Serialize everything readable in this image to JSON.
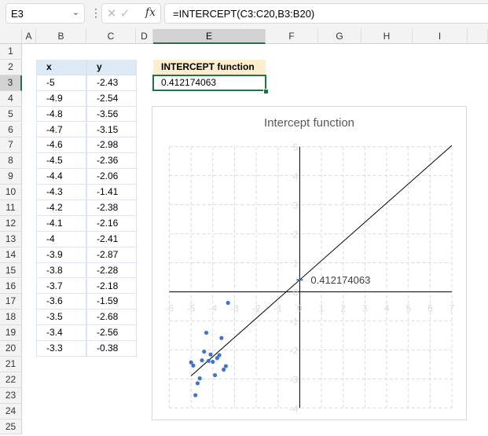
{
  "name_box": {
    "value": "E3"
  },
  "formula_bar": {
    "value": "=INTERCEPT(C3:C20,B3:B20)",
    "cancel_icon": "x-icon",
    "enter_icon": "check-icon",
    "fx_label": "fx"
  },
  "columns": [
    "A",
    "B",
    "C",
    "D",
    "E",
    "F",
    "G",
    "H",
    "I"
  ],
  "selected_column": "E",
  "rows": [
    "1",
    "2",
    "3",
    "4",
    "5",
    "6",
    "7",
    "8",
    "9",
    "10",
    "11",
    "12",
    "13",
    "14",
    "15",
    "16",
    "17",
    "18",
    "19",
    "20",
    "21",
    "22",
    "23",
    "24",
    "25"
  ],
  "selected_row": "3",
  "table": {
    "headers": [
      "x",
      "y"
    ],
    "x": [
      "-5",
      "-4.9",
      "-4.8",
      "-4.7",
      "-4.6",
      "-4.5",
      "-4.4",
      "-4.3",
      "-4.2",
      "-4.1",
      "-4",
      "-3.9",
      "-3.8",
      "-3.7",
      "-3.6",
      "-3.5",
      "-3.4",
      "-3.3"
    ],
    "y": [
      "-2.43",
      "-2.54",
      "-3.56",
      "-3.15",
      "-2.98",
      "-2.36",
      "-2.06",
      "-1.41",
      "-2.38",
      "-2.16",
      "-2.41",
      "-2.87",
      "-2.28",
      "-2.18",
      "-1.59",
      "-2.68",
      "-2.56",
      "-0.38"
    ]
  },
  "result": {
    "header": "INTERCEPT function",
    "value": "0.412174063"
  },
  "chart_data": {
    "type": "scatter",
    "title": "Intercept function",
    "x": [
      -5,
      -4.9,
      -4.8,
      -4.7,
      -4.6,
      -4.5,
      -4.4,
      -4.3,
      -4.2,
      -4.1,
      -4,
      -3.9,
      -3.8,
      -3.7,
      -3.6,
      -3.5,
      -3.4,
      -3.3
    ],
    "y": [
      -2.43,
      -2.54,
      -3.56,
      -3.15,
      -2.98,
      -2.36,
      -2.06,
      -1.41,
      -2.38,
      -2.16,
      -2.41,
      -2.87,
      -2.28,
      -2.18,
      -1.59,
      -2.68,
      -2.56,
      -0.38
    ],
    "trendline": {
      "type": "linear",
      "x_range": [
        -5,
        7
      ]
    },
    "intercept_point": {
      "x": 0,
      "y": 0.412174063,
      "label": "0.412174063"
    },
    "xlim": [
      -6,
      7
    ],
    "ylim": [
      -4,
      5
    ],
    "xticks": [
      "-6",
      "-5",
      "-4",
      "-3",
      "-2",
      "-1",
      "0",
      "1",
      "2",
      "3",
      "4",
      "5",
      "6",
      "7"
    ],
    "yticks": [
      "-4",
      "-3",
      "-2",
      "-1",
      "0",
      "1",
      "2",
      "3",
      "4",
      "5"
    ],
    "grid": true,
    "colors": {
      "points": "#4472c4",
      "trendline": "#000000",
      "grid": "#d9d9d9"
    }
  }
}
